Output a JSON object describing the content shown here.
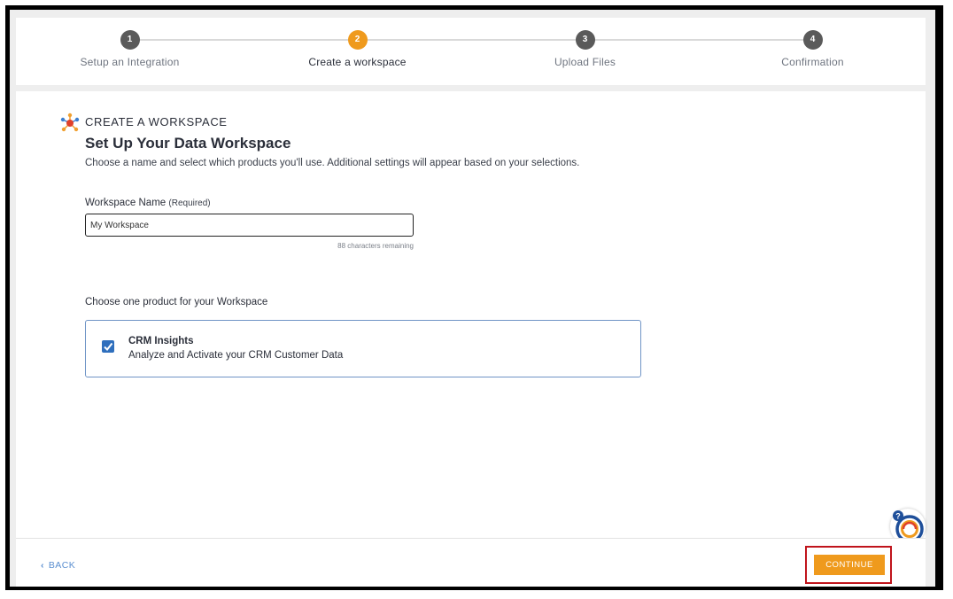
{
  "stepper": {
    "steps": [
      {
        "number": "1",
        "label": "Setup an Integration",
        "state": "done"
      },
      {
        "number": "2",
        "label": "Create a workspace",
        "state": "active"
      },
      {
        "number": "3",
        "label": "Upload Files",
        "state": "pending"
      },
      {
        "number": "4",
        "label": "Confirmation",
        "state": "pending"
      }
    ]
  },
  "header": {
    "kicker": "CREATE A WORKSPACE",
    "title": "Set Up Your Data Workspace",
    "subtitle": "Choose a name and select which products you'll use. Additional settings will appear based on your selections."
  },
  "workspace_name": {
    "label": "Workspace Name",
    "required": "(Required)",
    "value": "My Workspace",
    "remaining": "88 characters remaining"
  },
  "products": {
    "label": "Choose one product for your Workspace",
    "items": [
      {
        "name": "CRM Insights",
        "description": "Analyze and Activate your CRM Customer Data",
        "checked": true
      }
    ]
  },
  "footer": {
    "back_label": "BACK",
    "continue_label": "CONTINUE"
  },
  "colors": {
    "accent": "#ef9a1d",
    "link": "#5b8fd0",
    "checkbox": "#2f6fbd",
    "highlight_box": "#c0141c"
  },
  "icons": [
    "workspace-logo-icon",
    "checkmark-icon",
    "chevron-left-icon",
    "help-icon"
  ]
}
